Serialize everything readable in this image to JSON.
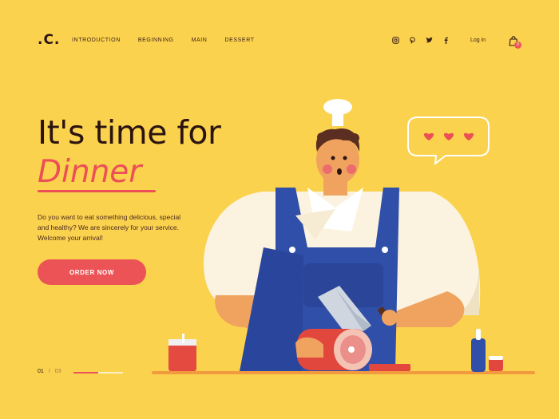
{
  "logo": ".C.",
  "nav": [
    "INTRODUCTION",
    "BEGINNING",
    "MAIN",
    "DESSERT"
  ],
  "social_icons": [
    "instagram-icon",
    "pinterest-icon",
    "twitter-icon",
    "facebook-icon"
  ],
  "login_label": "Log in",
  "cart": {
    "icon": "shopping-bag-icon",
    "count": "0"
  },
  "hero": {
    "line1": "It's time for",
    "line2": "Dinner",
    "description": "Do you want to eat something delicious, special and healthy? We are sincerely for your service. Welcome your arrival!",
    "cta_label": "ORDER NOW"
  },
  "pagination": {
    "current": "01",
    "separator": "/",
    "total": "03",
    "progress": 0.5
  },
  "speech_bubble": {
    "hearts": 3
  },
  "colors": {
    "background": "#fbd24e",
    "accent": "#ec5357",
    "text": "#2b1410",
    "apron": "#2f4fa8"
  }
}
